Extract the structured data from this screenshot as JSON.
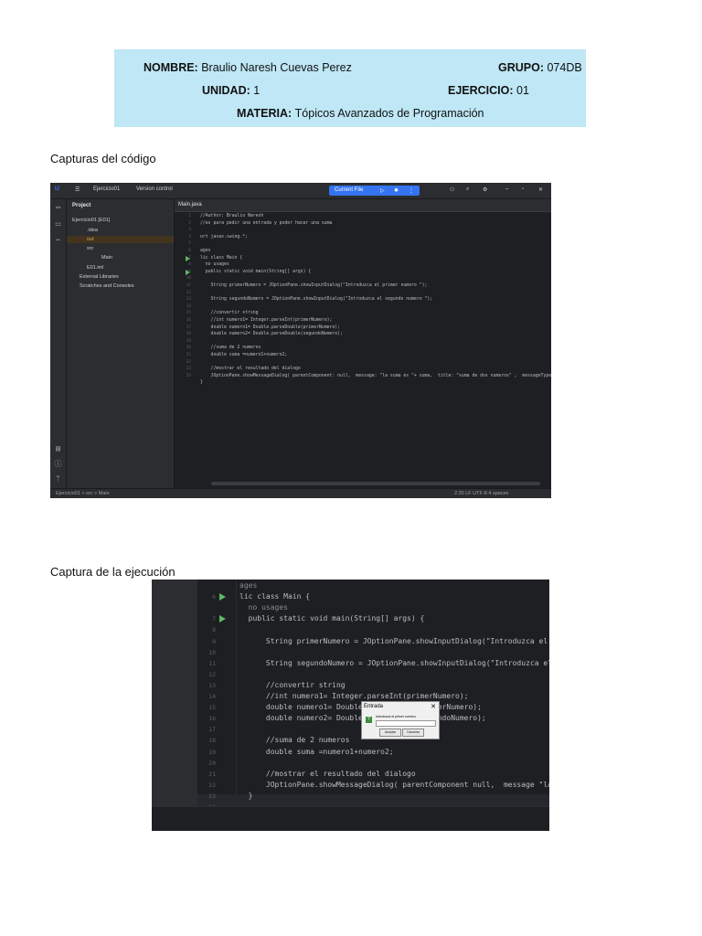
{
  "header": {
    "nombre_label": "NOMBRE:",
    "nombre_value": "Braulio Naresh Cuevas Perez",
    "grupo_label": "GRUPO:",
    "grupo_value": "074DB",
    "unidad_label": "UNIDAD:",
    "unidad_value": "1",
    "ejercicio_label": "EJERCICIO:",
    "ejercicio_value": "01",
    "materia_label": "MATERIA:",
    "materia_value": "Tópicos Avanzados de Programación",
    "bg_color": "#bfe7f6"
  },
  "sections": {
    "code_title": "Capturas del código",
    "exec_title": "Captura de la ejecución"
  },
  "ide": {
    "project_name": "Ejercicio01",
    "vcs": "Version control",
    "run_config": "Current File",
    "project_panel": "Project",
    "tree": [
      {
        "label": "Ejercicio01 [E01]",
        "depth": 0
      },
      {
        "label": ".idea",
        "depth": 1
      },
      {
        "label": "out",
        "depth": 1
      },
      {
        "label": "src",
        "depth": 1
      },
      {
        "label": "Main",
        "depth": 2
      },
      {
        "label": "E01.iml",
        "depth": 1
      },
      {
        "label": "External Libraries",
        "depth": 0
      },
      {
        "label": "Scratches and Consoles",
        "depth": 0
      }
    ],
    "tab": "Main.java",
    "status_left": "Ejercicio01 > src > Main",
    "status_right": "2:20   LF   UTF-8   4 spaces",
    "code_lines": [
      "//Author: Braulio Naresh",
      "//es para pedir una entrada y poder hacer una suma",
      "",
      "ort javax.swing.*;",
      "",
      "ages",
      "lic class Main {",
      "  no usages",
      "  public static void main(String[] args) {",
      "",
      "    String primerNumero = JOptionPane.showInputDialog(\"Introduzca el primer numero \");",
      "",
      "    String segundoNumero = JOptionPane.showInputDialog(\"Introduzca el segundo numero \");",
      "",
      "    //convertir string",
      "    //int numero1= Integer.parseInt(primerNumero);",
      "    double numero1= Double.parseDouble(primerNumero);",
      "    double numero2= Double.parseDouble(segundoNumero);",
      "",
      "    //suma de 2 numeros",
      "    double suma =numero1+numero2;",
      "",
      "    //mostrar el resultado del dialogo",
      "    JOptionPane.showMessageDialog( parentComponent: null,  message: \"la suma es \"+ suma,  title: \"suma de dos numeros\" ,  messageType: 1);",
      "}",
      ""
    ],
    "line_numbers": [
      "1",
      "2",
      "3",
      "4",
      "5",
      "6",
      "7",
      "8",
      "9",
      "10",
      "11",
      "12",
      "13",
      "14",
      "15",
      "16",
      "17",
      "18",
      "19",
      "20",
      "21",
      "22",
      "23",
      "24"
    ]
  },
  "exec": {
    "lines": [
      {
        "n": "",
        "t": "ages"
      },
      {
        "n": "6",
        "t": "lic class Main {"
      },
      {
        "n": "",
        "t": "  no usages"
      },
      {
        "n": "7",
        "t": "  public static void main(String[] args) {"
      },
      {
        "n": "8",
        "t": ""
      },
      {
        "n": "9",
        "t": "      String primerNumero = JOptionPane.showInputDialog(\"Introduzca el prim"
      },
      {
        "n": "10",
        "t": ""
      },
      {
        "n": "11",
        "t": "      String segundoNumero = JOptionPane.showInputDialog(\"Introduzca el seg"
      },
      {
        "n": "12",
        "t": ""
      },
      {
        "n": "13",
        "t": "      //convertir string"
      },
      {
        "n": "14",
        "t": "      //int numero1= Integer.parseInt(primerNumero);"
      },
      {
        "n": "15",
        "t": "      double numero1= Double.parseDouble(primerNumero);"
      },
      {
        "n": "16",
        "t": "      double numero2= Double.parseDouble(segundoNumero);"
      },
      {
        "n": "17",
        "t": ""
      },
      {
        "n": "18",
        "t": "      //suma de 2 numeros"
      },
      {
        "n": "19",
        "t": "      double suma =numero1+numero2;"
      },
      {
        "n": "20",
        "t": ""
      },
      {
        "n": "21",
        "t": "      //mostrar el resultado del dialogo"
      },
      {
        "n": "22",
        "t": "      JOptionPane.showMessageDialog( parentComponent null,  message \"la suma es"
      },
      {
        "n": "23",
        "t": "  }"
      },
      {
        "n": "24",
        "t": ""
      }
    ],
    "dialog": {
      "title": "Entrada",
      "message": "Introduzca el primer numero",
      "ok": "Aceptar",
      "cancel": "Cancelar"
    }
  }
}
